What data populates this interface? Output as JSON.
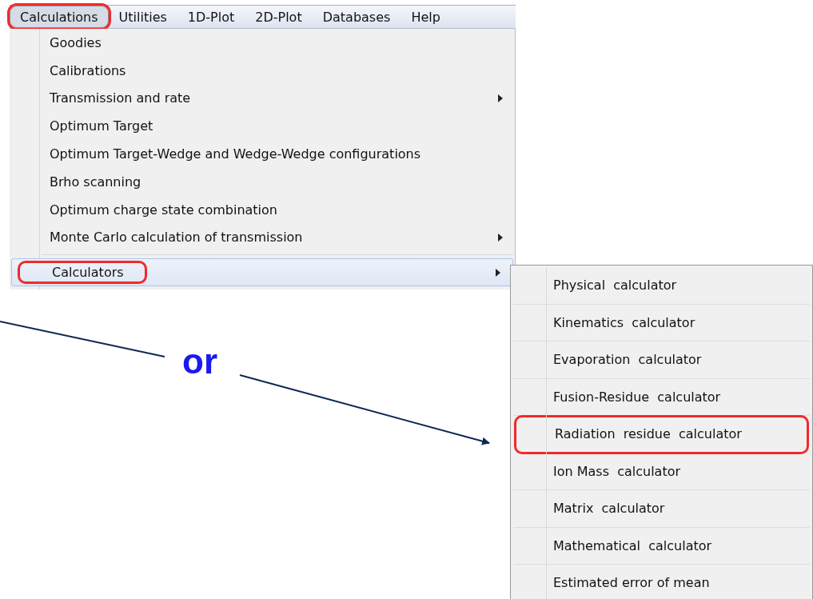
{
  "menubar": [
    {
      "label": "Calculations",
      "selected": true,
      "highlighted": true
    },
    {
      "label": "Utilities",
      "selected": false,
      "highlighted": false
    },
    {
      "label": "1D-Plot",
      "selected": false,
      "highlighted": false
    },
    {
      "label": "2D-Plot",
      "selected": false,
      "highlighted": false
    },
    {
      "label": "Databases",
      "selected": false,
      "highlighted": false
    },
    {
      "label": "Help",
      "selected": false,
      "highlighted": false
    }
  ],
  "menu": {
    "items": [
      {
        "kind": "item",
        "label": "Goodies",
        "submenu": false,
        "selected": false,
        "highlighted": false
      },
      {
        "kind": "item",
        "label": "Calibrations",
        "submenu": false,
        "selected": false,
        "highlighted": false
      },
      {
        "kind": "item",
        "label": "Transmission and rate",
        "submenu": true,
        "selected": false,
        "highlighted": false
      },
      {
        "kind": "item",
        "label": "Optimum Target",
        "submenu": false,
        "selected": false,
        "highlighted": false
      },
      {
        "kind": "item",
        "label": "Optimum Target-Wedge and Wedge-Wedge configurations",
        "submenu": false,
        "selected": false,
        "highlighted": false
      },
      {
        "kind": "item",
        "label": "Brho scanning",
        "submenu": false,
        "selected": false,
        "highlighted": false
      },
      {
        "kind": "item",
        "label": "Optimum charge state combination",
        "submenu": false,
        "selected": false,
        "highlighted": false
      },
      {
        "kind": "item",
        "label": "Monte Carlo calculation of transmission",
        "submenu": true,
        "selected": false,
        "highlighted": false
      },
      {
        "kind": "separator"
      },
      {
        "kind": "item",
        "label": "Calculators",
        "submenu": true,
        "selected": true,
        "highlighted": true
      }
    ]
  },
  "submenu": {
    "items": [
      {
        "label": "Physical  calculator",
        "highlighted": false
      },
      {
        "label": "Kinematics  calculator",
        "highlighted": false
      },
      {
        "label": "Evaporation  calculator",
        "highlighted": false
      },
      {
        "label": "Fusion-Residue  calculator",
        "highlighted": false
      },
      {
        "label": "Radiation  residue  calculator",
        "highlighted": true
      },
      {
        "label": "Ion Mass  calculator",
        "highlighted": false
      },
      {
        "label": "Matrix  calculator",
        "highlighted": false
      },
      {
        "label": "Mathematical  calculator",
        "highlighted": false
      },
      {
        "label": "Estimated error of mean",
        "highlighted": false
      }
    ]
  },
  "annotation": {
    "text": "or"
  }
}
